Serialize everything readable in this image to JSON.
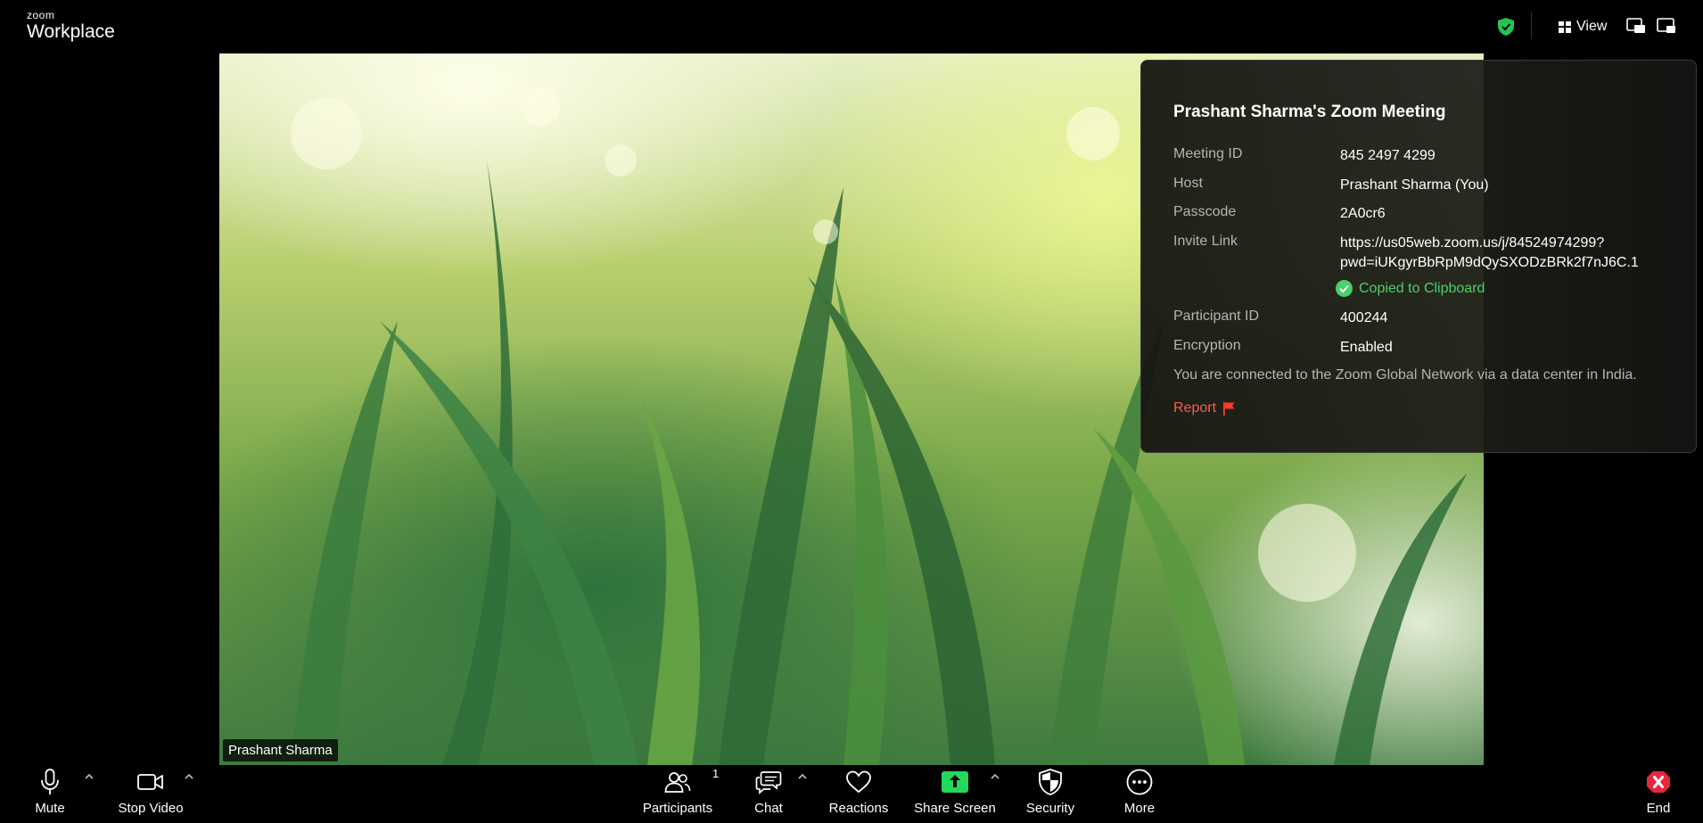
{
  "brand": {
    "line1": "zoom",
    "line2": "Workplace"
  },
  "topbar": {
    "view_label": "View"
  },
  "video": {
    "participant_name": "Prashant Sharma"
  },
  "meeting_info": {
    "title": "Prashant Sharma's Zoom Meeting",
    "meeting_id_label": "Meeting ID",
    "meeting_id": "845 2497 4299",
    "host_label": "Host",
    "host": "Prashant Sharma (You)",
    "passcode_label": "Passcode",
    "passcode": "2A0cr6",
    "invite_label": "Invite Link",
    "invite_line1": "https://us05web.zoom.us/j/84524974299?",
    "invite_line2": "pwd=iUKgyrBbRpM9dQySXODzBRk2f7nJ6C.1",
    "copied_text": "Copied to Clipboard",
    "participant_id_label": "Participant ID",
    "participant_id": "400244",
    "encryption_label": "Encryption",
    "encryption": "Enabled",
    "network_note": "You are connected to the Zoom Global Network via a data center in India.",
    "report_label": "Report"
  },
  "toolbar": {
    "mute": "Mute",
    "stop_video": "Stop Video",
    "participants": "Participants",
    "participant_count": "1",
    "chat": "Chat",
    "reactions": "Reactions",
    "share_screen": "Share Screen",
    "security": "Security",
    "more": "More",
    "end": "End"
  },
  "colors": {
    "accent_green": "#4ccf6c",
    "share_green": "#23d959",
    "report_red": "#ff5b4a",
    "end_red": "#e8263c"
  }
}
